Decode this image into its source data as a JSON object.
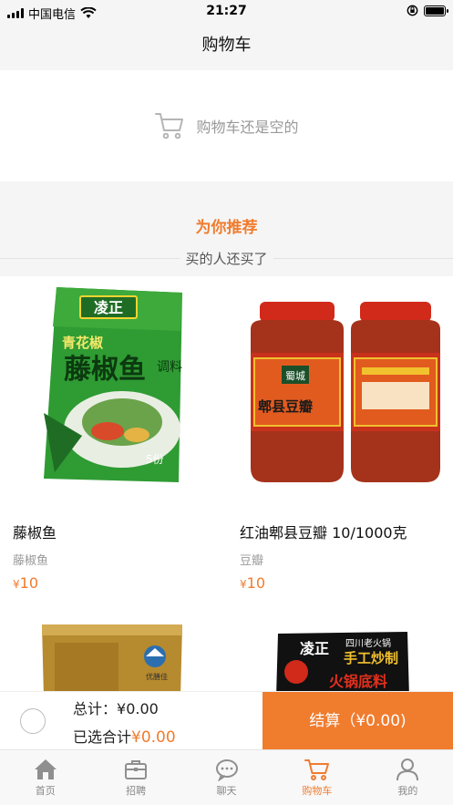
{
  "status_bar": {
    "carrier": "中国电信",
    "time": "21:27"
  },
  "nav": {
    "title": "购物车"
  },
  "empty_cart": {
    "text": "购物车还是空的",
    "icon": "cart-icon"
  },
  "recommend": {
    "title": "为你推荐",
    "subtitle": "买的人还买了"
  },
  "products": [
    {
      "name": "藤椒鱼",
      "category": "藤椒鱼",
      "currency": "¥",
      "price": "10",
      "package_brand": "凌正",
      "package_text": "青花椒藤椒鱼调料"
    },
    {
      "name": "红油郫县豆瓣 10/1000克",
      "category": "豆瓣",
      "currency": "¥",
      "price": "10",
      "package_brand": "蜀城",
      "package_text": "郫县豆瓣"
    },
    {
      "name": "",
      "category": "",
      "currency": "",
      "price": "",
      "package_brand": "",
      "package_text": ""
    },
    {
      "name": "",
      "category": "",
      "currency": "",
      "price": "",
      "package_brand": "凌正",
      "package_text": "四川老火锅 手工炒制 火锅底料"
    }
  ],
  "checkout": {
    "total_label": "总计：",
    "total_value": "¥0.00",
    "selected_label": "已选合计",
    "selected_value": "¥0.00",
    "button_label": "结算（¥0.00)"
  },
  "tabs": [
    {
      "label": "首页",
      "icon": "home-icon",
      "active": false
    },
    {
      "label": "招聘",
      "icon": "briefcase-icon",
      "active": false
    },
    {
      "label": "聊天",
      "icon": "chat-icon",
      "active": false
    },
    {
      "label": "购物车",
      "icon": "cart-icon",
      "active": true
    },
    {
      "label": "我的",
      "icon": "user-icon",
      "active": false
    }
  ],
  "colors": {
    "accent": "#f07c2e",
    "background": "#f5f5f5"
  }
}
